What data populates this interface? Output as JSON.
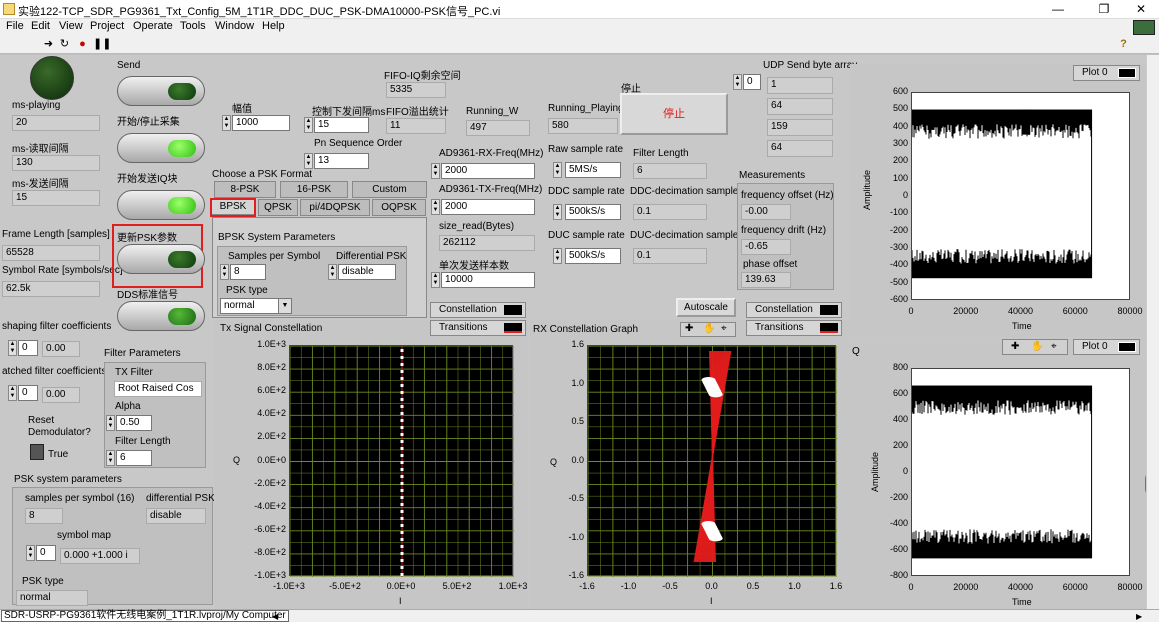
{
  "window": {
    "title": "实验122-TCP_SDR_PG9361_Txt_Config_5M_1T1R_DDC_DUC_PSK-DMA10000-PSK信号_PC.vi",
    "minimize": "—",
    "maximize": "❐",
    "close": "✕"
  },
  "menu": [
    "File",
    "Edit",
    "View",
    "Project",
    "Operate",
    "Tools",
    "Window",
    "Help"
  ],
  "toolbar": {
    "help": "?"
  },
  "left": {
    "ms_playing_label": "ms-playing",
    "ms_playing": "20",
    "ms_read_label": "ms-读取间隔",
    "ms_read": "130",
    "ms_send_label": "ms-发送间隔",
    "ms_send": "15",
    "frame_length_label": "Frame Length [samples]",
    "frame_length": "65528",
    "symbol_rate_label": "Symbol Rate [symbols/sec]",
    "symbol_rate": "62.5k",
    "shaping_label": "shaping filter coefficients",
    "shaping_idx": "0",
    "shaping_val": "0.00",
    "matched_label": "atched filter coefficients",
    "matched_idx": "0",
    "matched_val": "0.00",
    "reset_label": "Reset\nDemodulator?",
    "reset_state": "True",
    "psk_sys_label": "PSK system parameters",
    "sps_label": "samples per symbol (16)",
    "sps": "8",
    "diff_label": "differential PSK",
    "diff": "disable",
    "symbol_map_label": "symbol map",
    "symbol_map_idx": "0",
    "symbol_map_val": "0.000 +1.000 i",
    "psk_type_label": "PSK type",
    "psk_type": "normal"
  },
  "buttons": {
    "send": "Send",
    "start_stop": "开始/停止采集",
    "start_iq": "开始发送IQ块",
    "update_psk": "更新PSK参数",
    "dds": "DDS标准信号"
  },
  "filter": {
    "title": "Filter Parameters",
    "tx_filter_label": "TX Filter",
    "tx_filter": "Root Raised Cos",
    "alpha_label": "Alpha",
    "alpha": "0.50",
    "length_label": "Filter Length",
    "length": "6"
  },
  "mid": {
    "amp_label": "幅值",
    "amp": "1000",
    "ctrl_interval_label": "控制下发间隔ms",
    "ctrl_interval": "15",
    "pn_label": "Pn Sequence Order",
    "pn": "13",
    "fifo_iq_label": "FIFO-IQ剩余空间",
    "fifo_iq": "5335",
    "fifo_over_label": "FIFO溢出统计",
    "fifo_over": "11",
    "running_w_label": "Running_W",
    "running_w": "497",
    "running_p_label": "Running_Playing",
    "running_p": "580",
    "stop_label": "停止",
    "stop_btn": "停止"
  },
  "psk_format": {
    "label": "Choose a PSK Format",
    "tabs_back": [
      "8-PSK",
      "16-PSK",
      "Custom"
    ],
    "tabs_front": [
      "BPSK",
      "QPSK",
      "pi/4DQPSK",
      "OQPSK"
    ],
    "sys_label": "BPSK System Parameters",
    "sps_label": "Samples per Symbol",
    "sps": "8",
    "diff_label": "Differential PSK",
    "diff": "disable",
    "type_label": "PSK type",
    "type": "normal"
  },
  "rf": {
    "rx_freq_label": "AD9361-RX-Freq(MHz)",
    "rx_freq": "2000",
    "tx_freq_label": "AD9361-TX-Freq(MHz)",
    "tx_freq": "2000",
    "size_read_label": "size_read(Bytes)",
    "size_read": "262112",
    "single_label": "单次发送样本数",
    "single": "10000",
    "raw_label": "Raw sample rate",
    "raw": "5MS/s",
    "flen_label": "Filter Length",
    "flen": "6",
    "ddc_label": "DDC sample rate",
    "ddc": "500kS/s",
    "ddc_dec_label": "DDC-decimation sample",
    "ddc_dec": "0.1",
    "duc_label": "DUC sample rate",
    "duc": "500kS/s",
    "duc_dec_label": "DUC-decimation sample",
    "duc_dec": "0.1"
  },
  "udp": {
    "label": "UDP Send byte array",
    "idx": "0",
    "values": [
      "1",
      "64",
      "159",
      "64"
    ]
  },
  "measure": {
    "title": "Measurements",
    "fo_label": "frequency offset (Hz)",
    "fo": "-0.00",
    "fd_label": "frequency drift (Hz)",
    "fd": "-0.65",
    "po_label": "phase offset",
    "po": "139.63"
  },
  "tx_const": {
    "title": "Tx Signal Constellation",
    "legend1": "Constellation",
    "legend2": "Transitions",
    "ylabel": "Q",
    "xlabel": "I",
    "yticks": [
      "1.0E+3",
      "8.0E+2",
      "6.0E+2",
      "4.0E+2",
      "2.0E+2",
      "0.0E+0",
      "-2.0E+2",
      "-4.0E+2",
      "-6.0E+2",
      "-8.0E+2",
      "-1.0E+3"
    ],
    "xticks": [
      "-1.0E+3",
      "-5.0E+2",
      "0.0E+0",
      "5.0E+2",
      "1.0E+3"
    ]
  },
  "rx_const": {
    "title": "RX Constellation Graph",
    "autoscale": "Autoscale",
    "legend1": "Constellation",
    "legend2": "Transitions",
    "ylabel": "Q",
    "xlabel": "I",
    "yticks": [
      "1.6",
      "1.0",
      "0.5",
      "0.0",
      "-0.5",
      "-1.0",
      "-1.6"
    ],
    "xticks": [
      "-1.6",
      "-1.0",
      "-0.5",
      "0.0",
      "0.5",
      "1.0",
      "1.6"
    ]
  },
  "plot_i": {
    "legend": "Plot 0",
    "ylabel": "Amplitude",
    "xlabel": "Time",
    "yticks": [
      "600",
      "500",
      "400",
      "300",
      "200",
      "100",
      "0",
      "-100",
      "-200",
      "-300",
      "-400",
      "-500",
      "-600"
    ],
    "xticks": [
      "0",
      "20000",
      "40000",
      "60000",
      "80000"
    ]
  },
  "plot_q": {
    "title": "Q",
    "legend": "Plot 0",
    "ylabel": "Amplitude",
    "xlabel": "Time",
    "yticks": [
      "800",
      "600",
      "400",
      "200",
      "0",
      "-200",
      "-400",
      "-600",
      "-800"
    ],
    "xticks": [
      "0",
      "20000",
      "40000",
      "60000",
      "80000"
    ]
  },
  "status": {
    "path": "SDR-USRP-PG9361软件无线电案例_1T1R.lvproj/My Computer"
  },
  "colors": {
    "accent_red": "#e21d1d",
    "grid": "#6e8c1e",
    "panel": "#c8c8c8"
  }
}
